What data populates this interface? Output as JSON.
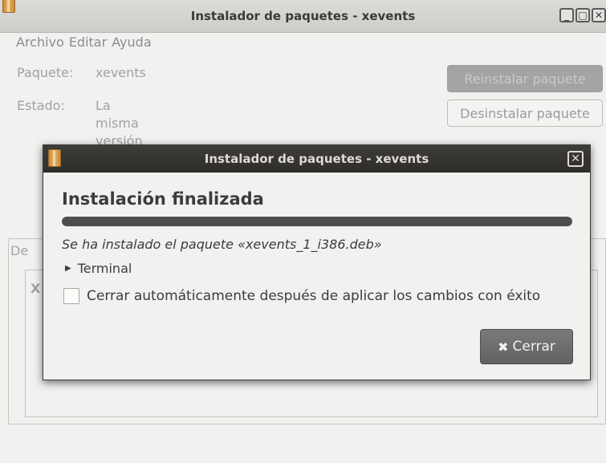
{
  "main_window": {
    "title": "Instalador de paquetes - xevents",
    "menu": [
      "Archivo",
      "Editar",
      "Ayuda"
    ],
    "package_label": "Paquete:",
    "package_value": "xevents",
    "status_label": "Estado:",
    "status_value_lines": [
      "La",
      "misma",
      "versión"
    ],
    "reinstall_button": "Reinstalar paquete",
    "uninstall_button": "Desinstalar paquete",
    "tab_stub": "De",
    "inner_stub": "X"
  },
  "dialog": {
    "title": "Instalador de paquetes - xevents",
    "heading": "Instalación finalizada",
    "progress": 1.0,
    "status": "Se ha instalado el paquete «xevents_1_i386.deb»",
    "expander_label": "Terminal",
    "checkbox_label": "Cerrar automáticamente después de aplicar los cambios con éxito",
    "checkbox_checked": false,
    "close_button": "Cerrar"
  },
  "icons": {
    "app": "package-icon",
    "window_controls": [
      "minimize-icon",
      "maximize-icon",
      "close-icon"
    ],
    "expander": "triangle-right-icon",
    "close_button": "x-icon"
  },
  "colors": {
    "dialog_titlebar": "#3e3d39",
    "progress_fill": "#4d4d4d",
    "close_button": "#6f6f6f"
  }
}
